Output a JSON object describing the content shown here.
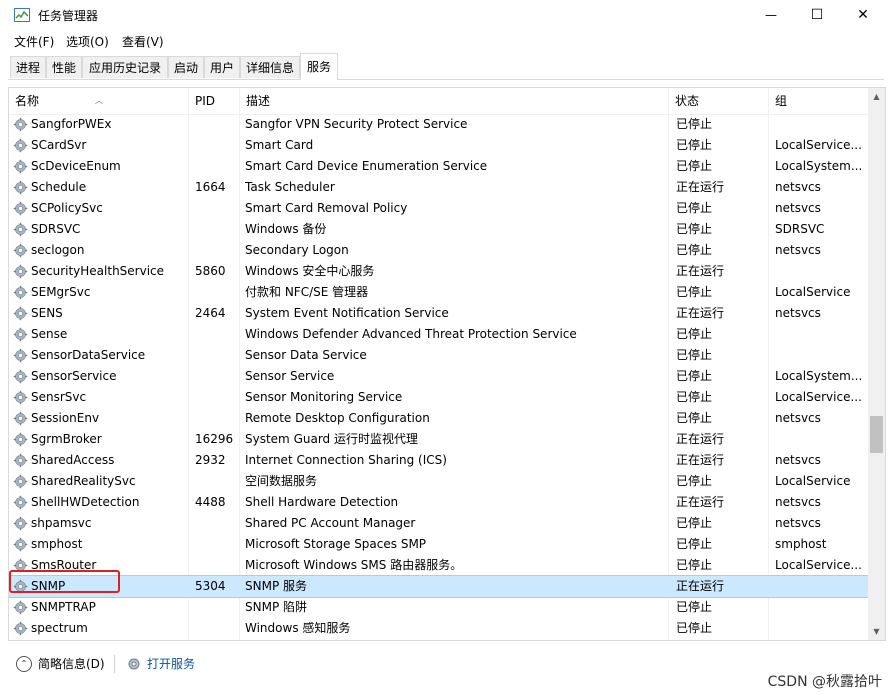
{
  "window": {
    "title": "任务管理器",
    "min_glyph": "—",
    "max_glyph": "☐",
    "close_glyph": "✕"
  },
  "menu": [
    "文件(F)",
    "选项(O)",
    "查看(V)"
  ],
  "tabs": [
    "进程",
    "性能",
    "应用历史记录",
    "启动",
    "用户",
    "详细信息",
    "服务"
  ],
  "active_tab": "服务",
  "columns": {
    "name": "名称",
    "pid": "PID",
    "desc": "描述",
    "status": "状态",
    "group": "组"
  },
  "rows": [
    {
      "name": "SangforPWEx",
      "pid": "",
      "desc": "Sangfor VPN Security Protect Service",
      "status": "已停止",
      "group": ""
    },
    {
      "name": "SCardSvr",
      "pid": "",
      "desc": "Smart Card",
      "status": "已停止",
      "group": "LocalService..."
    },
    {
      "name": "ScDeviceEnum",
      "pid": "",
      "desc": "Smart Card Device Enumeration Service",
      "status": "已停止",
      "group": "LocalSystem..."
    },
    {
      "name": "Schedule",
      "pid": "1664",
      "desc": "Task Scheduler",
      "status": "正在运行",
      "group": "netsvcs"
    },
    {
      "name": "SCPolicySvc",
      "pid": "",
      "desc": "Smart Card Removal Policy",
      "status": "已停止",
      "group": "netsvcs"
    },
    {
      "name": "SDRSVC",
      "pid": "",
      "desc": "Windows 备份",
      "status": "已停止",
      "group": "SDRSVC"
    },
    {
      "name": "seclogon",
      "pid": "",
      "desc": "Secondary Logon",
      "status": "已停止",
      "group": "netsvcs"
    },
    {
      "name": "SecurityHealthService",
      "pid": "5860",
      "desc": "Windows 安全中心服务",
      "status": "正在运行",
      "group": ""
    },
    {
      "name": "SEMgrSvc",
      "pid": "",
      "desc": "付款和 NFC/SE 管理器",
      "status": "已停止",
      "group": "LocalService"
    },
    {
      "name": "SENS",
      "pid": "2464",
      "desc": "System Event Notification Service",
      "status": "正在运行",
      "group": "netsvcs"
    },
    {
      "name": "Sense",
      "pid": "",
      "desc": "Windows Defender Advanced Threat Protection Service",
      "status": "已停止",
      "group": ""
    },
    {
      "name": "SensorDataService",
      "pid": "",
      "desc": "Sensor Data Service",
      "status": "已停止",
      "group": ""
    },
    {
      "name": "SensorService",
      "pid": "",
      "desc": "Sensor Service",
      "status": "已停止",
      "group": "LocalSystem..."
    },
    {
      "name": "SensrSvc",
      "pid": "",
      "desc": "Sensor Monitoring Service",
      "status": "已停止",
      "group": "LocalService..."
    },
    {
      "name": "SessionEnv",
      "pid": "",
      "desc": "Remote Desktop Configuration",
      "status": "已停止",
      "group": "netsvcs"
    },
    {
      "name": "SgrmBroker",
      "pid": "16296",
      "desc": "System Guard 运行时监视代理",
      "status": "正在运行",
      "group": ""
    },
    {
      "name": "SharedAccess",
      "pid": "2932",
      "desc": "Internet Connection Sharing (ICS)",
      "status": "正在运行",
      "group": "netsvcs"
    },
    {
      "name": "SharedRealitySvc",
      "pid": "",
      "desc": "空间数据服务",
      "status": "已停止",
      "group": "LocalService"
    },
    {
      "name": "ShellHWDetection",
      "pid": "4488",
      "desc": "Shell Hardware Detection",
      "status": "正在运行",
      "group": "netsvcs"
    },
    {
      "name": "shpamsvc",
      "pid": "",
      "desc": "Shared PC Account Manager",
      "status": "已停止",
      "group": "netsvcs"
    },
    {
      "name": "smphost",
      "pid": "",
      "desc": "Microsoft Storage Spaces SMP",
      "status": "已停止",
      "group": "smphost"
    },
    {
      "name": "SmsRouter",
      "pid": "",
      "desc": "Microsoft Windows SMS 路由器服务。",
      "status": "已停止",
      "group": "LocalService..."
    },
    {
      "name": "SNMP",
      "pid": "5304",
      "desc": "SNMP 服务",
      "status": "正在运行",
      "group": ""
    },
    {
      "name": "SNMPTRAP",
      "pid": "",
      "desc": "SNMP 陷阱",
      "status": "已停止",
      "group": ""
    },
    {
      "name": "spectrum",
      "pid": "",
      "desc": "Windows 感知服务",
      "status": "已停止",
      "group": ""
    }
  ],
  "selected_index": 22,
  "footer": {
    "fewer_details": "简略信息(D)",
    "open_services": "打开服务"
  },
  "watermark": "CSDN @秋露拾叶",
  "colors": {
    "selection": "#cce8ff",
    "highlight": "#e02020",
    "link": "#0b50a8"
  }
}
